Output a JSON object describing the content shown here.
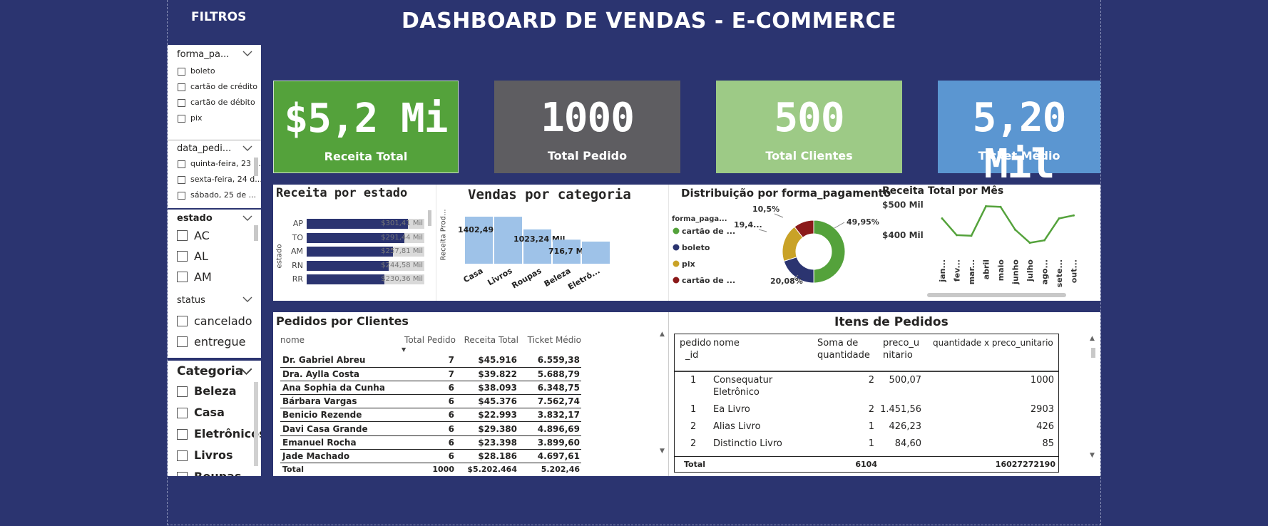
{
  "header": {
    "title": "DASHBOARD DE VENDAS - E-COMMERCE",
    "filters_label": "FILTROS"
  },
  "slicers": {
    "forma_pagamento": {
      "title": "forma_pa...",
      "options": [
        "boleto",
        "cartão de crédito",
        "cartão de débito",
        "pix"
      ]
    },
    "data_pedido": {
      "title": "data_pedi...",
      "options": [
        "quinta-feira, 23 ...",
        "sexta-feira, 24 d...",
        "sábado, 25 de ..."
      ]
    },
    "estado": {
      "title": "estado",
      "options": [
        "AC",
        "AL",
        "AM"
      ]
    },
    "status": {
      "title": "status",
      "options": [
        "cancelado",
        "entregue"
      ]
    },
    "categoria": {
      "title": "Categoria",
      "options": [
        "Beleza",
        "Casa",
        "Eletrônicos",
        "Livros",
        "Roupas"
      ]
    }
  },
  "kpis": [
    {
      "value": "$5,2 Mi",
      "label": "Receita Total",
      "color": "#54a23b"
    },
    {
      "value": "1000",
      "label": "Total Pedido",
      "color": "#5e5d61"
    },
    {
      "value": "500",
      "label": "Total Clientes",
      "color": "#9dca86"
    },
    {
      "value": "5,20 Mil",
      "label": "Ticket Médio",
      "color": "#5b96d1"
    }
  ],
  "charts": {
    "receita_estado": {
      "title": "Receita por estado",
      "ylabel": "estado",
      "categories": [
        "AP",
        "TO",
        "AM",
        "RN",
        "RR"
      ],
      "values": [
        301.41,
        291.44,
        257.81,
        244.58,
        230.36
      ],
      "value_labels": [
        "$301,41 Mil",
        "$291,44 Mil",
        "$257,81 Mil",
        "$244,58 Mil",
        "$230,36 Mil"
      ],
      "color": "#2b3470"
    },
    "vendas_categoria": {
      "title": "Vendas por categoria",
      "ylabel": "Receita Prod...",
      "categories": [
        "Casa",
        "Livros",
        "Roupas",
        "Beleza",
        "Eletrô..."
      ],
      "values": [
        1402.49,
        1400,
        1023.24,
        716.7,
        660
      ],
      "value_labels": [
        "1402,49 Mil",
        "",
        "1023,24 Mil",
        "716,7 Mil",
        ""
      ],
      "color": "#9ec2e8"
    },
    "forma_pagamento": {
      "title": "Distribuição por forma_pagamento",
      "legend_title": "forma_paga...",
      "slices": [
        {
          "name": "cartão de ...",
          "value": 49.95,
          "label": "49,95%",
          "color": "#54a23b"
        },
        {
          "name": "boleto",
          "value": 20.08,
          "label": "20,08%",
          "color": "#2b3470"
        },
        {
          "name": "pix",
          "value": 19.47,
          "label": "19,4...",
          "color": "#c9a227"
        },
        {
          "name": "cartão de ...",
          "value": 10.5,
          "label": "10,5%",
          "color": "#8b1a1a"
        }
      ]
    },
    "receita_mes": {
      "title": "Receita Total por Mês",
      "y_ticks": [
        "$500 Mil",
        "$400 Mil"
      ],
      "months": [
        "jan...",
        "fev...",
        "mar...",
        "abril",
        "maio",
        "junho",
        "julho",
        "ago...",
        "sete...",
        "out..."
      ],
      "values": [
        455,
        400,
        398,
        495,
        493,
        418,
        375,
        383,
        455,
        465
      ],
      "ylim": [
        360,
        510
      ],
      "color": "#54a23b"
    }
  },
  "pedidos_clientes": {
    "title": "Pedidos por Clientes",
    "columns": [
      "nome",
      "Total Pedido",
      "Receita Total",
      "Ticket Médio"
    ],
    "rows": [
      [
        "Dr. Gabriel Abreu",
        "7",
        "$45.916",
        "6.559,38"
      ],
      [
        "Dra. Aylla Costa",
        "7",
        "$39.822",
        "5.688,79"
      ],
      [
        "Ana Sophia da Cunha",
        "6",
        "$38.093",
        "6.348,75"
      ],
      [
        "Bárbara Vargas",
        "6",
        "$45.376",
        "7.562,74"
      ],
      [
        "Benicio Rezende",
        "6",
        "$22.993",
        "3.832,17"
      ],
      [
        "Davi Casa Grande",
        "6",
        "$29.380",
        "4.896,69"
      ],
      [
        "Emanuel Rocha",
        "6",
        "$23.398",
        "3.899,60"
      ],
      [
        "Jade Machado",
        "6",
        "$28.186",
        "4.697,61"
      ]
    ],
    "total": [
      "Total",
      "1000",
      "$5.202.464",
      "5.202,46"
    ]
  },
  "itens_pedidos": {
    "title": "Itens de Pedidos",
    "columns": [
      "pedido_id",
      "nome",
      "Soma de quantidade",
      "preco_unitario",
      "quantidade x preco_unitario"
    ],
    "column_lines": [
      [
        "pedido",
        "_id"
      ],
      [
        "nome"
      ],
      [
        "Soma de",
        "quantidade"
      ],
      [
        "preco_u",
        "nitario"
      ],
      [
        "quantidade x preco_unitario"
      ]
    ],
    "rows": [
      [
        "1",
        "Consequatur Eletrônico",
        "2",
        "500,07",
        "1000"
      ],
      [
        "1",
        "Ea Livro",
        "2",
        "1.451,56",
        "2903"
      ],
      [
        "2",
        "Alias Livro",
        "1",
        "426,23",
        "426"
      ],
      [
        "2",
        "Distinctio Livro",
        "1",
        "84,60",
        "85"
      ]
    ],
    "total": [
      "Total",
      "",
      "6104",
      "",
      "16027272190"
    ]
  }
}
